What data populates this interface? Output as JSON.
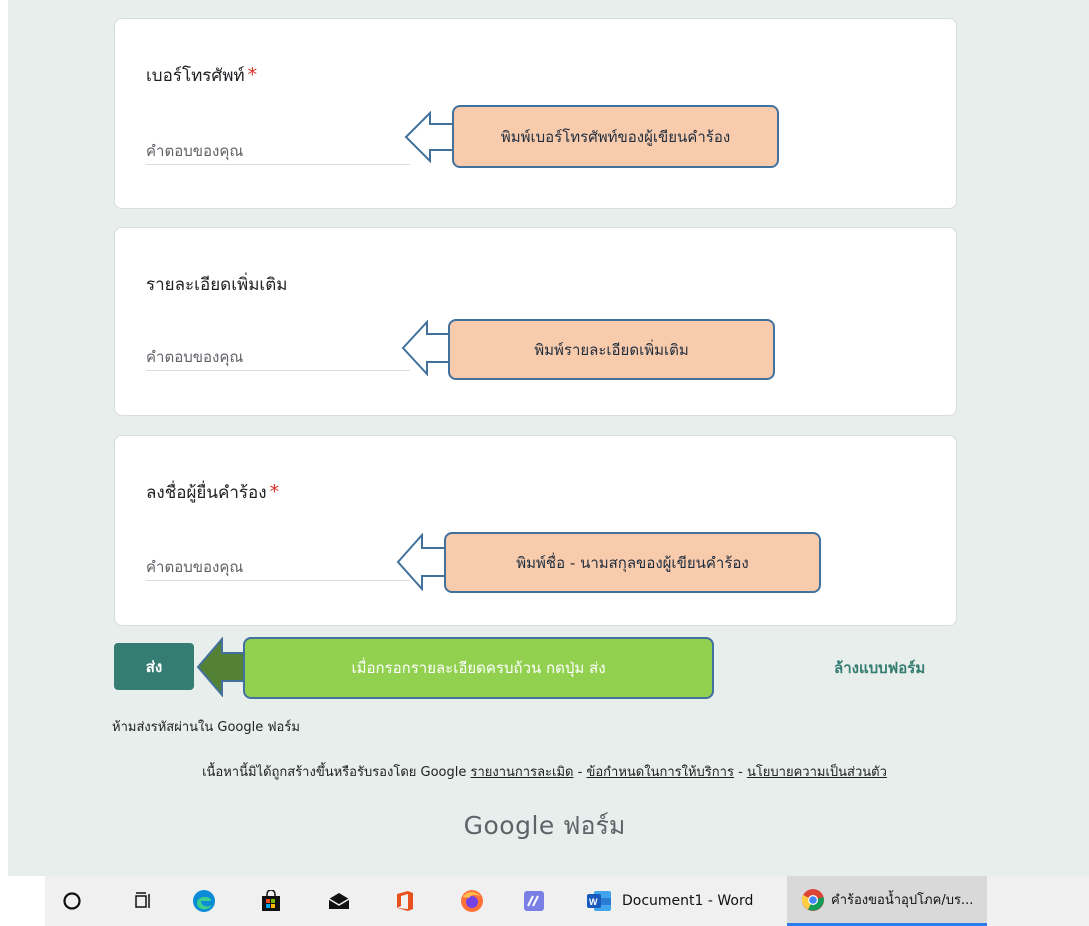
{
  "questions": [
    {
      "title": "เบอร์โทรศัพท์",
      "required_mark": "*",
      "placeholder": "คำตอบของคุณ"
    },
    {
      "title": "รายละเอียดเพิ่มเติม",
      "placeholder": "คำตอบของคุณ"
    },
    {
      "title": "ลงชื่อผู้ยื่นคำร้อง",
      "required_mark": "*",
      "placeholder": "คำตอบของคุณ"
    }
  ],
  "callouts": {
    "phone": "พิมพ์เบอร์โทรศัพท์ของผู้เขียนคำร้อง",
    "details": "พิมพ์รายละเอียดเพิ่มเติม",
    "name": "พิมพ์ชื่อ - นามสกุลของผู้เขียนคำร้อง",
    "submit": "เมื่อกรอกรายละเอียดครบถ้วน กดปุ่ม ส่ง"
  },
  "actions": {
    "submit_label": "ส่ง",
    "clear_label": "ล้างแบบฟอร์ม"
  },
  "footer": {
    "password_warning": "ห้ามส่งรหัสผ่านใน Google ฟอร์ม",
    "disclaimer": "เนื้อหานี้มิได้ถูกสร้างขึ้นหรือรับรองโดย Google",
    "links": [
      "รายงานการละเมิด",
      "ข้อกำหนดในการให้บริการ",
      "นโยบายความเป็นส่วนตัว"
    ],
    "separator": "-",
    "brand_google": "Google",
    "brand_forms": "ฟอร์ม"
  },
  "taskbar": {
    "icons": [
      "cortana-icon",
      "task-view-icon",
      "edge-icon",
      "store-icon",
      "mail-icon",
      "office-icon",
      "firefox-icon",
      "app-icon"
    ],
    "apps": [
      {
        "icon": "word-icon",
        "label": "Document1 - Word"
      },
      {
        "icon": "chrome-icon",
        "label": "คำร้องขอน้ำอุปโภค/บร..."
      }
    ]
  },
  "colors": {
    "page_bg": "#e8eeec",
    "accent": "#357d72",
    "required": "#d93025",
    "callout_peach": "#f8cbad",
    "callout_green": "#92d050",
    "callout_border": "#41719c",
    "arrow_dark_green": "#548235"
  }
}
